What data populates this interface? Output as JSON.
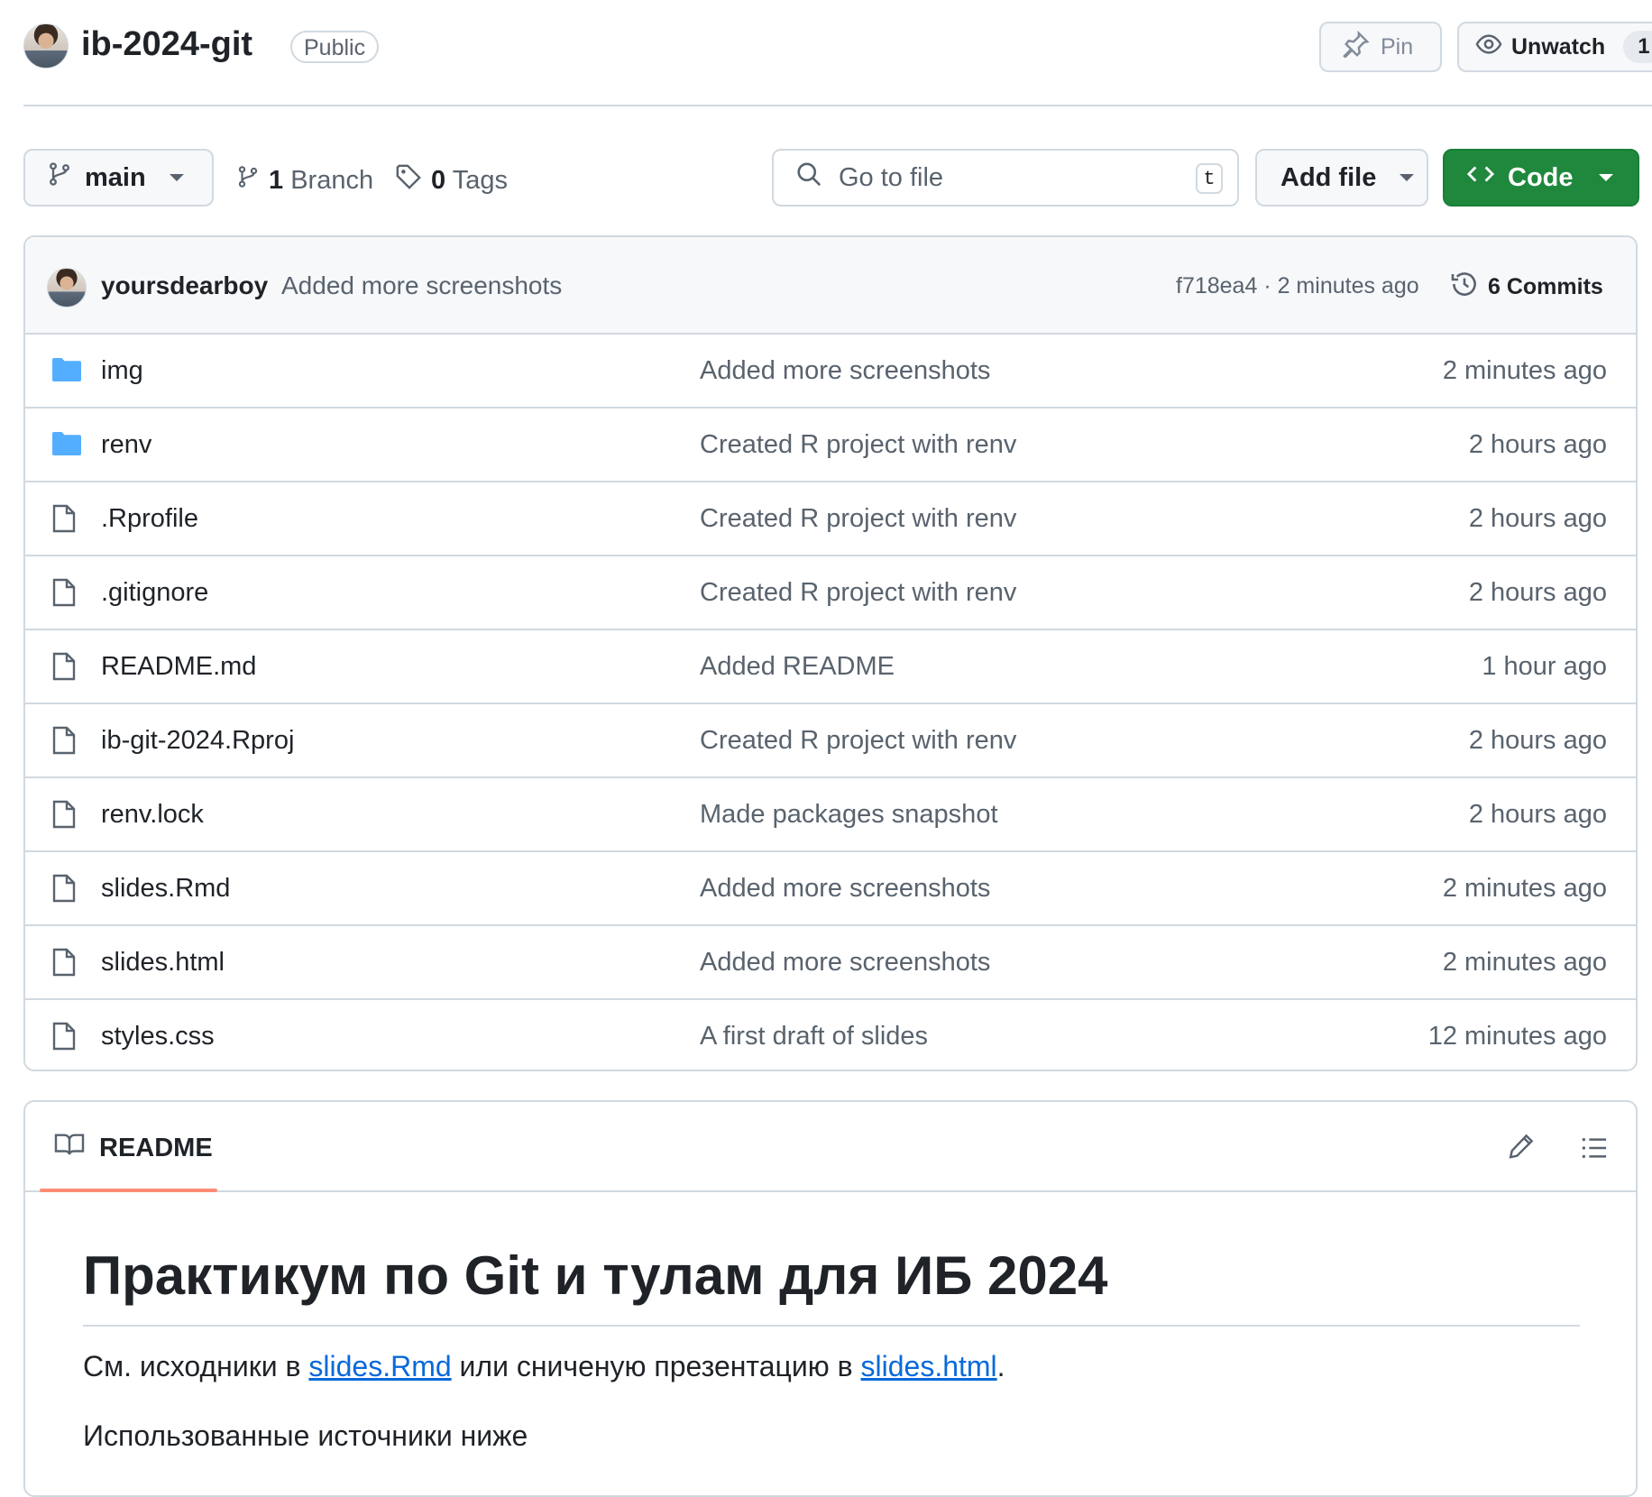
{
  "repo": {
    "name": "ib-2024-git",
    "visibility": "Public",
    "pin_label": "Pin",
    "unwatch_label": "Unwatch",
    "watch_count": "1"
  },
  "toolbar": {
    "branch": "main",
    "branch_count": "1",
    "branch_label": "Branch",
    "tag_count": "0",
    "tag_label": "Tags",
    "search_placeholder": "Go to file",
    "search_shortcut": "t",
    "add_file_label": "Add file",
    "code_label": "Code"
  },
  "latest_commit": {
    "author": "yoursdearboy",
    "message": "Added more screenshots",
    "meta": "f718ea4 · 2 minutes ago",
    "commits_label": "6 Commits"
  },
  "files": [
    {
      "name": "img",
      "type": "folder",
      "message": "Added more screenshots",
      "time": "2 minutes ago"
    },
    {
      "name": "renv",
      "type": "folder",
      "message": "Created R project with renv",
      "time": "2 hours ago"
    },
    {
      "name": ".Rprofile",
      "type": "file",
      "message": "Created R project with renv",
      "time": "2 hours ago"
    },
    {
      "name": ".gitignore",
      "type": "file",
      "message": "Created R project with renv",
      "time": "2 hours ago"
    },
    {
      "name": "README.md",
      "type": "file",
      "message": "Added README",
      "time": "1 hour ago"
    },
    {
      "name": "ib-git-2024.Rproj",
      "type": "file",
      "message": "Created R project with renv",
      "time": "2 hours ago"
    },
    {
      "name": "renv.lock",
      "type": "file",
      "message": "Made packages snapshot",
      "time": "2 hours ago"
    },
    {
      "name": "slides.Rmd",
      "type": "file",
      "message": "Added more screenshots",
      "time": "2 minutes ago"
    },
    {
      "name": "slides.html",
      "type": "file",
      "message": "Added more screenshots",
      "time": "2 minutes ago"
    },
    {
      "name": "styles.css",
      "type": "file",
      "message": "A first draft of slides",
      "time": "12 minutes ago"
    }
  ],
  "readme": {
    "tab_label": "README",
    "title": "Практикум по Git и тулам для ИБ 2024",
    "p1_prefix": "См. исходники в ",
    "p1_link1": "slides.Rmd",
    "p1_middle": " или сниченую презентацию в ",
    "p1_link2": "slides.html",
    "p1_suffix": ".",
    "p2": "Использованные источники ниже"
  },
  "colors": {
    "accent_green": "#1f883d",
    "link_blue": "#0969da",
    "folder_blue": "#54aeff",
    "tab_underline": "#fd8c73"
  },
  "icons": [
    "pin-icon",
    "eye-icon",
    "git-branch-icon",
    "tag-icon",
    "search-icon",
    "code-icon",
    "history-icon",
    "folder-icon",
    "file-icon",
    "book-icon",
    "pencil-icon",
    "list-icon"
  ]
}
